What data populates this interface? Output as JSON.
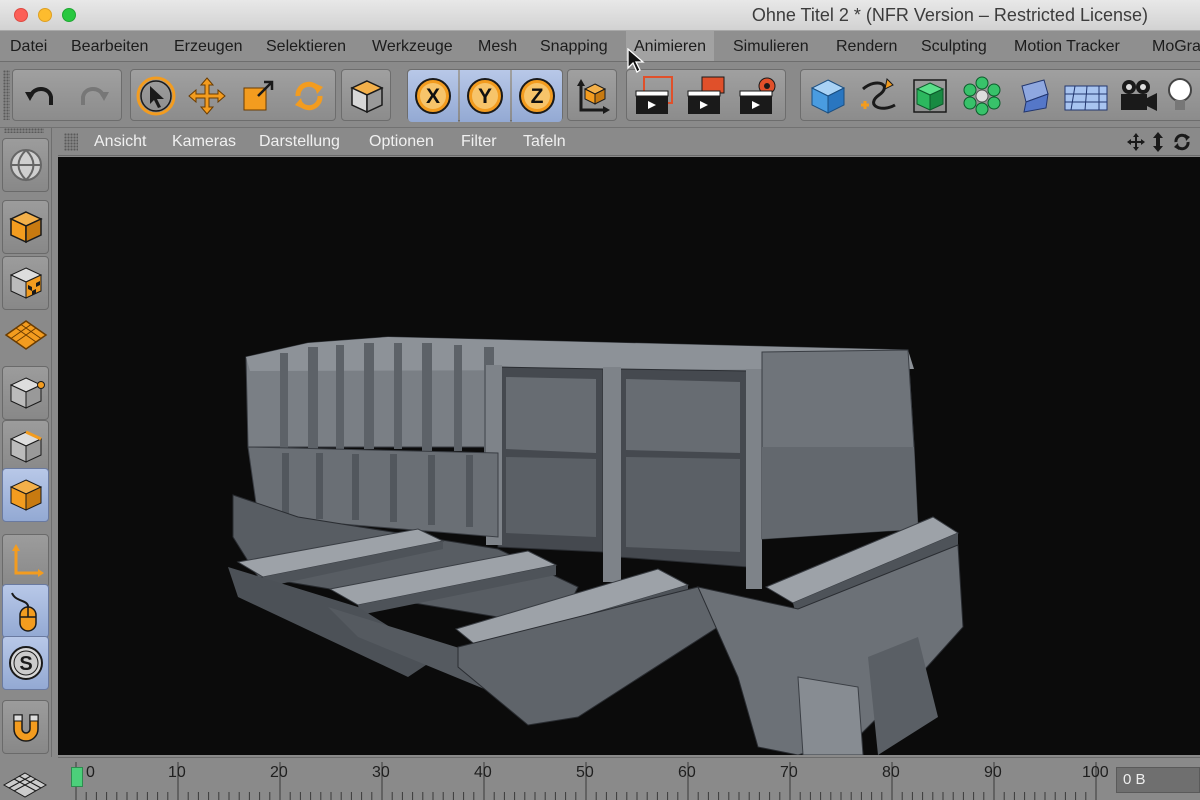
{
  "window": {
    "title": "Ohne Titel 2 * (NFR Version – Restricted License)"
  },
  "menubar": {
    "items": [
      "Datei",
      "Bearbeiten",
      "Erzeugen",
      "Selektieren",
      "Werkzeuge",
      "Mesh",
      "Snapping",
      "Animieren",
      "Simulieren",
      "Rendern",
      "Sculpting",
      "Motion Tracker",
      "MoGra"
    ],
    "active": "Animieren"
  },
  "toolbar": {
    "undo_icon": "undo-icon",
    "redo_icon": "redo-icon",
    "tools": [
      "select-arrow-icon",
      "move-icon",
      "scale-icon",
      "rotate-icon",
      "recent-object-icon"
    ],
    "axis_buttons": [
      "X",
      "Y",
      "Z"
    ],
    "coordinate_system_icon": "world-coordinate-icon",
    "render_buttons": [
      "render-view-icon",
      "render-picture-viewer-icon",
      "render-settings-icon"
    ],
    "create_buttons": [
      "cube-icon",
      "spline-pen-icon",
      "subdivision-surface-icon",
      "mograph-cloner-icon",
      "deformer-icon",
      "floor-scene-icon",
      "camera-icon",
      "light-icon"
    ],
    "accent_orange": "#f39c1f",
    "accent_blue": "#9fb3da"
  },
  "leftbar": {
    "items": [
      "polygon-mode-icon",
      "texture-mode-icon",
      "workplane-icon",
      "points-mode-icon",
      "edges-mode-icon",
      "polygons-mode-icon",
      "axis-mode-icon",
      "tweak-mode-icon",
      "snap-icon",
      "magnet-icon",
      "grid-snap-icon"
    ],
    "active": "polygons-mode-icon"
  },
  "viewport": {
    "menu": [
      "Ansicht",
      "Kameras",
      "Darstellung",
      "Optionen",
      "Filter",
      "Tafeln"
    ],
    "nav_icons": [
      "pan-icon",
      "dolly-icon",
      "orbit-icon"
    ]
  },
  "timeline": {
    "tick_labels": [
      "0",
      "10",
      "20",
      "30",
      "40",
      "50",
      "60",
      "70",
      "80",
      "90",
      "100"
    ],
    "current_frame": 0,
    "frame_readout": "0 B"
  }
}
